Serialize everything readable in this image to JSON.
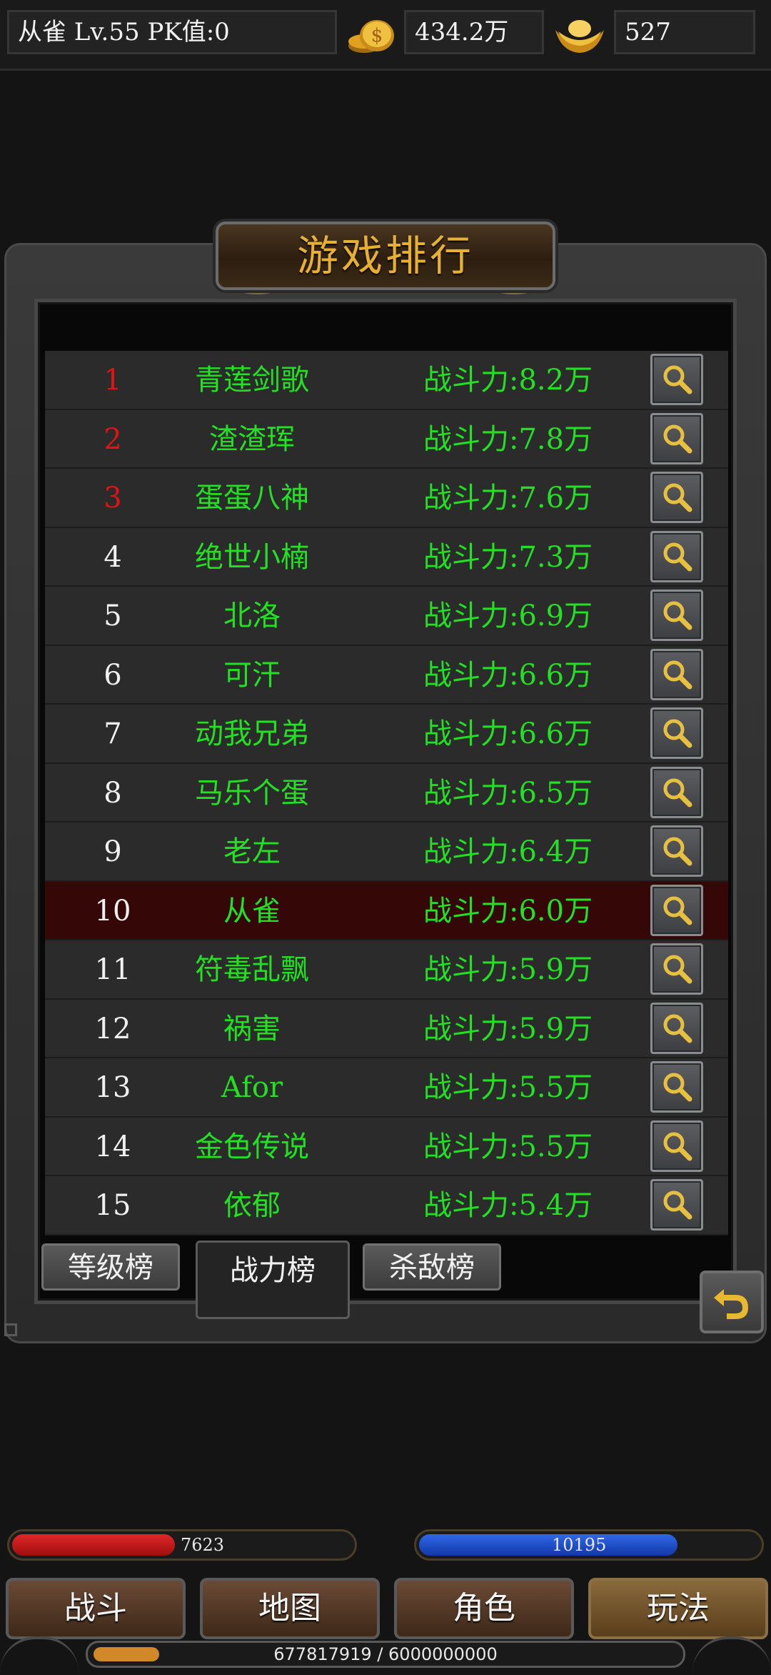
{
  "status": {
    "player": "从雀  Lv.55 PK值:0",
    "gold": "434.2万",
    "ingot": "527"
  },
  "panel": {
    "title": "游戏排行"
  },
  "rankings": [
    {
      "rank": "1",
      "name": "青莲剑歌",
      "power": "战斗力:8.2万"
    },
    {
      "rank": "2",
      "name": "渣渣珲",
      "power": "战斗力:7.8万"
    },
    {
      "rank": "3",
      "name": "蛋蛋八神",
      "power": "战斗力:7.6万"
    },
    {
      "rank": "4",
      "name": "绝世小楠",
      "power": "战斗力:7.3万"
    },
    {
      "rank": "5",
      "name": "北洛",
      "power": "战斗力:6.9万"
    },
    {
      "rank": "6",
      "name": "可汗",
      "power": "战斗力:6.6万"
    },
    {
      "rank": "7",
      "name": "动我兄弟",
      "power": "战斗力:6.6万"
    },
    {
      "rank": "8",
      "name": "马乐个蛋",
      "power": "战斗力:6.5万"
    },
    {
      "rank": "9",
      "name": "老左",
      "power": "战斗力:6.4万"
    },
    {
      "rank": "10",
      "name": "从雀",
      "power": "战斗力:6.0万"
    },
    {
      "rank": "11",
      "name": "符毒乱飘",
      "power": "战斗力:5.9万"
    },
    {
      "rank": "12",
      "name": "祸害",
      "power": "战斗力:5.9万"
    },
    {
      "rank": "13",
      "name": "Afor",
      "power": "战斗力:5.5万"
    },
    {
      "rank": "14",
      "name": "金色传说",
      "power": "战斗力:5.5万"
    },
    {
      "rank": "15",
      "name": "依郁",
      "power": "战斗力:5.4万"
    }
  ],
  "highlight_rank": "10",
  "tabs": {
    "level": "等级榜",
    "power": "战力榜",
    "kills": "杀敌榜"
  },
  "bars": {
    "hp": "7623",
    "hp_fill": 0.48,
    "mp": "10195",
    "mp_fill": 0.76,
    "exp": "677817919 / 6000000000",
    "exp_fill": 0.113
  },
  "nav": {
    "battle": "战斗",
    "map": "地图",
    "character": "角色",
    "gameplay": "玩法"
  },
  "colors": {
    "top3_rank": "#e01414",
    "name_power": "#22e022",
    "highlight_row": "#350707",
    "hp": "#c01818",
    "mp": "#1848c8",
    "title": "#e8b030"
  },
  "icons": {
    "gold": "gold-coins-icon",
    "ingot": "gold-ingot-icon",
    "view": "magnifier-icon",
    "back": "return-arrow-icon"
  }
}
